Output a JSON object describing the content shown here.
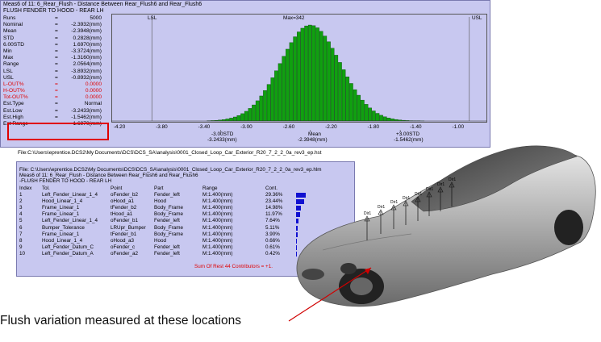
{
  "histogram": {
    "title_lines": [
      "Meas6 of 11: 6_Rear_Flush - Distance Between Rear_Flush6 and Rear_Flush6",
      "FLUSH FENDER TO HOOD - REAR LH"
    ],
    "stats": [
      {
        "label": "Runs",
        "value": "5000",
        "red": false
      },
      {
        "label": "Nominal",
        "value": "-2.3932(mm)",
        "red": false
      },
      {
        "label": "Mean",
        "value": "-2.3948(mm)",
        "red": false
      },
      {
        "label": "STD",
        "value": "0.2828(mm)",
        "red": false
      },
      {
        "label": "6.00STD",
        "value": "1.6970(mm)",
        "red": false
      },
      {
        "label": "Min",
        "value": "-3.3724(mm)",
        "red": false
      },
      {
        "label": "Max",
        "value": "-1.3160(mm)",
        "red": false
      },
      {
        "label": "Range",
        "value": "2.0564(mm)",
        "red": false
      },
      {
        "label": "LSL",
        "value": "-3.8932(mm)",
        "red": false
      },
      {
        "label": "USL",
        "value": "-0.8932(mm)",
        "red": false
      },
      {
        "label": "L-OUT%",
        "value": "0.0000",
        "red": true
      },
      {
        "label": "H-OUT%",
        "value": "0.0000",
        "red": true
      },
      {
        "label": "Tot-OUT%",
        "value": "0.0000",
        "red": true
      },
      {
        "label": "Est.Type",
        "value": "Normal",
        "red": false
      },
      {
        "label": "Est.Low",
        "value": "-3.2433(mm)",
        "red": false
      },
      {
        "label": "Est.High",
        "value": "-1.5462(mm)",
        "red": false
      },
      {
        "label": "Est Range",
        "value": "1.6970(mm)",
        "red": false
      }
    ],
    "lsl_label": "LSL",
    "usl_label": "USL",
    "max_label": "Max=342",
    "below_labels": {
      "minus3": "-3.00STD",
      "minus3_val": "-3.2433(mm)",
      "mean": "Mean",
      "mean_val": "-2.3948(mm)",
      "plus3": "+3.00STD",
      "plus3_val": "-1.5462(mm)"
    },
    "file_line": "File:C:\\Users\\eprentice.DCS2\\My Documents\\DCS\\DCS_SA\\analysis\\0001_Closed_Loop_Car_Exterior_R20_7_2_2_0a_rev3_ep.hst"
  },
  "chart_data": {
    "type": "bar",
    "title": "Meas6 of 11: 6_Rear_Flush - Distance Between Rear_Flush6 and Rear_Flush6",
    "x_ticks": [
      -4.2,
      -3.8,
      -3.4,
      -3.0,
      -2.6,
      -2.2,
      -1.8,
      -1.4,
      -1.0
    ],
    "xlim": [
      -4.2,
      -0.8
    ],
    "ylim": [
      0,
      342
    ],
    "lsl": -3.8932,
    "usl": -0.8932,
    "mean": -2.3948,
    "std": 0.2828,
    "max_count": 342,
    "est_low": -3.2433,
    "est_high": -1.5462,
    "bin_range": [
      -3.3724,
      -1.316
    ],
    "bin_count": 58,
    "bar_color": "#10a010"
  },
  "contributors": {
    "file_line": "File: C:\\Users\\eprentice.DCS2\\My Documents\\DCS\\DCS_SA\\analysis\\0001_Closed_Loop_Car_Exterior_R20_7_2_2_0a_rev3_ep.hlm",
    "meas_line": "Meas6 of 11: 6_Rear_Flush - Distance Between Rear_Flush6 and Rear_Flush6",
    "name_line": "-FLUSH FENDER TO HOOD - REAR LH",
    "headers": {
      "index": "Index",
      "tol": "Tol.",
      "point": "Point",
      "part": "Part",
      "range": "Range",
      "cont": "Cont."
    },
    "rows": [
      {
        "index": "1",
        "tol": "Left_Fender_Linear_1_4",
        "point": "oFender_b2",
        "part": "Fender_left",
        "range": "M:1.400(mm)",
        "cont": "29.36%",
        "pct": 29.36
      },
      {
        "index": "2",
        "tol": "Hood_Linear_1_4",
        "point": "oHood_a1",
        "part": "Hood",
        "range": "M:1.400(mm)",
        "cont": "23.44%",
        "pct": 23.44
      },
      {
        "index": "3",
        "tol": "Frame_Linear_1",
        "point": "tFender_b2",
        "part": "Body_Frame",
        "range": "M:1.400(mm)",
        "cont": "14.98%",
        "pct": 14.98
      },
      {
        "index": "4",
        "tol": "Frame_Linear_1",
        "point": "tHood_a1",
        "part": "Body_Frame",
        "range": "M:1.400(mm)",
        "cont": "11.97%",
        "pct": 11.97
      },
      {
        "index": "5",
        "tol": "Left_Fender_Linear_1_4",
        "point": "oFender_b1",
        "part": "Fender_left",
        "range": "M:1.400(mm)",
        "cont": "7.64%",
        "pct": 7.64
      },
      {
        "index": "6",
        "tol": "Bumper_Tolerance",
        "point": "LRUpr_Bumper",
        "part": "Body_Frame",
        "range": "M:1.400(mm)",
        "cont": "5.11%",
        "pct": 5.11
      },
      {
        "index": "7",
        "tol": "Frame_Linear_1",
        "point": "tFender_b1",
        "part": "Body_Frame",
        "range": "M:1.400(mm)",
        "cont": "3.90%",
        "pct": 3.9
      },
      {
        "index": "8",
        "tol": "Hood_Linear_1_4",
        "point": "oHood_a3",
        "part": "Hood",
        "range": "M:1.400(mm)",
        "cont": "0.66%",
        "pct": 0.66
      },
      {
        "index": "9",
        "tol": "Left_Fender_Datum_C",
        "point": "oFender_c",
        "part": "Fender_left",
        "range": "M:1.400(mm)",
        "cont": "0.61%",
        "pct": 0.61
      },
      {
        "index": "10",
        "tol": "Left_Fender_Datum_A",
        "point": "oFender_a2",
        "part": "Fender_left",
        "range": "M:1.400(mm)",
        "cont": "0.42%",
        "pct": 0.42
      }
    ],
    "rest_line": "Sum Of Rest 44 Contributors = +1.",
    "bar_color": "#1010d0"
  },
  "car": {
    "markers": [
      "Dir1",
      "Dir1",
      "Dir1",
      "Dir1",
      "Dir1",
      "Dir1",
      "Dir1",
      "Dir1"
    ],
    "body_color": "#b8b8b8"
  },
  "annotation": {
    "caption": "Flush variation measured at these locations",
    "arrow_color": "#d00000"
  }
}
